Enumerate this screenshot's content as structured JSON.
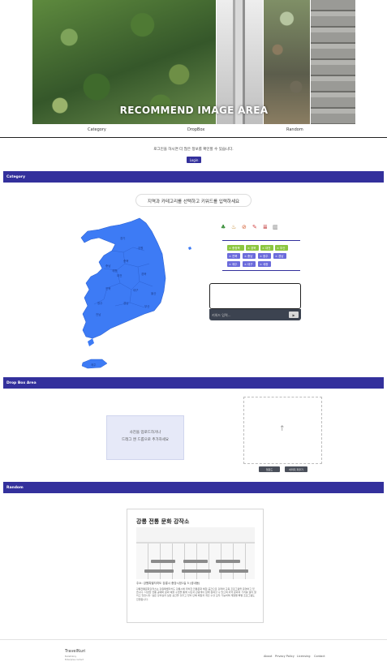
{
  "hero": {
    "title": "RECOMMEND IMAGE AREA"
  },
  "tabs": [
    {
      "label": "Category"
    },
    {
      "label": "DropBox"
    },
    {
      "label": "Random"
    }
  ],
  "login": {
    "message": "로그인을 하시면 더 많은 정보를 확인할 수 있습니다.",
    "button_label": "Login"
  },
  "category": {
    "header": "Category",
    "prompt": "지역과 카테고리를 선택하고 키워드를 입력하세요",
    "map_regions": [
      "경기",
      "강원",
      "충북",
      "충남",
      "세종",
      "대전",
      "경북",
      "전북",
      "대구",
      "울산",
      "경남",
      "광주",
      "전남",
      "부산",
      "제주"
    ],
    "filter_icons": [
      "tree-icon",
      "food-icon",
      "ban-icon",
      "clip-icon",
      "stack-icon",
      "trash-icon"
    ],
    "region_tags": [
      {
        "label": "× 충청북",
        "color": "#8cc63f"
      },
      {
        "label": "× 경북",
        "color": "#8cc63f"
      },
      {
        "label": "× 대전",
        "color": "#8cc63f"
      },
      {
        "label": "× 부산",
        "color": "#8cc63f"
      },
      {
        "label": "× 전북",
        "color": "#6b6bdb"
      },
      {
        "label": "× 충남",
        "color": "#6b6bdb"
      },
      {
        "label": "× 광주",
        "color": "#6b6bdb"
      },
      {
        "label": "× 경남",
        "color": "#6b6bdb"
      },
      {
        "label": "× 제주",
        "color": "#6b6bdb"
      },
      {
        "label": "× 대구",
        "color": "#6b6bdb"
      },
      {
        "label": "× 세종",
        "color": "#6b6bdb"
      }
    ],
    "keyword_placeholder": "키워드 입력...",
    "send_label": "▶"
  },
  "dropbox": {
    "header": "Drop Box Area",
    "drop_line1": "사진을 업로드하거나",
    "drop_line2": "드래그 앤 드롭으로 추가하세요",
    "upload_icon": "↑",
    "submit_label": "업로드",
    "reset_label": "이미지 지우기"
  },
  "random": {
    "header": "Random",
    "card_title": "강릉 전통 문화 강작소",
    "address": "주소: 강원특별자치도 강릉시 중앙시장1길 5 (성내동)",
    "description": "강릉전통문화강작소는 강원특별자치도 강릉시에 위치한 전통문화 체험 공간으로 강좌와 교육 프로그램을 운영하고 있습니다. 다양한 전통 공예와 문화 예술 수업을 통해 시민과 관광객이 함께 참여할 수 있으며 지역 문화의 가치를 널리 알리고 있습니다. 넓은 강의실과 실습 공간을 갖추고 있어 단체 체험과 개인 수강 모두 가능하며 계절별 특별 프로그램도 진행됩니다."
  },
  "footer": {
    "brand": "TravelNuri",
    "sub_line1": "Bulletinboy",
    "sub_line2": "Enterprise contact",
    "links": [
      "About",
      "Privacy Policy",
      "Licensing",
      "Contact"
    ]
  }
}
